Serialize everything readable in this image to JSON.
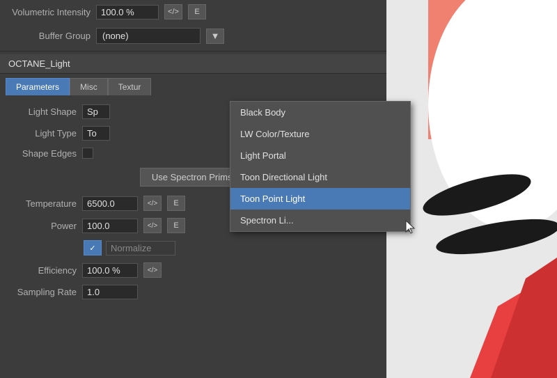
{
  "topBar": {
    "volumetricIntensityLabel": "Volumetric Intensity",
    "volumetricIntensityValue": "100.0 %",
    "codeButtonLabel": "</>",
    "eButtonLabel": "E",
    "bufferGroupLabel": "Buffer Group",
    "bufferGroupValue": "(none)"
  },
  "objectHeader": {
    "name": "OCTANE_Light"
  },
  "tabs": [
    {
      "label": "Parameters",
      "active": true
    },
    {
      "label": "Misc",
      "active": false
    },
    {
      "label": "Textur",
      "active": false
    }
  ],
  "properties": {
    "lightShapeLabel": "Light Shape",
    "lightShapeValue": "Sp",
    "lightTypeLabel": "Light Type",
    "lightTypeValue": "To",
    "shapeEdgesLabel": "Shape Edges",
    "useSpectronBtn": "Use Spectron Prims.",
    "temperatureLabel": "Temperature",
    "temperatureValue": "6500.0",
    "powerLabel": "Power",
    "powerValue": "100.0",
    "normalizeLabel": "Normalize",
    "efficiencyLabel": "Efficiency",
    "efficiencyValue": "100.0 %",
    "samplingRateLabel": "Sampling Rate",
    "samplingRateValue": "1.0"
  },
  "dropdown": {
    "items": [
      {
        "label": "Black Body",
        "selected": false
      },
      {
        "label": "LW Color/Texture",
        "selected": false
      },
      {
        "label": "Light Portal",
        "selected": false
      },
      {
        "label": "Toon Directional Light",
        "selected": false
      },
      {
        "label": "Toon Point Light",
        "selected": true
      },
      {
        "label": "Spectron Li...",
        "selected": false
      }
    ]
  },
  "icons": {
    "code": "</>",
    "e": "E",
    "dropdownArrow": "▼",
    "checkmark": "✓"
  }
}
